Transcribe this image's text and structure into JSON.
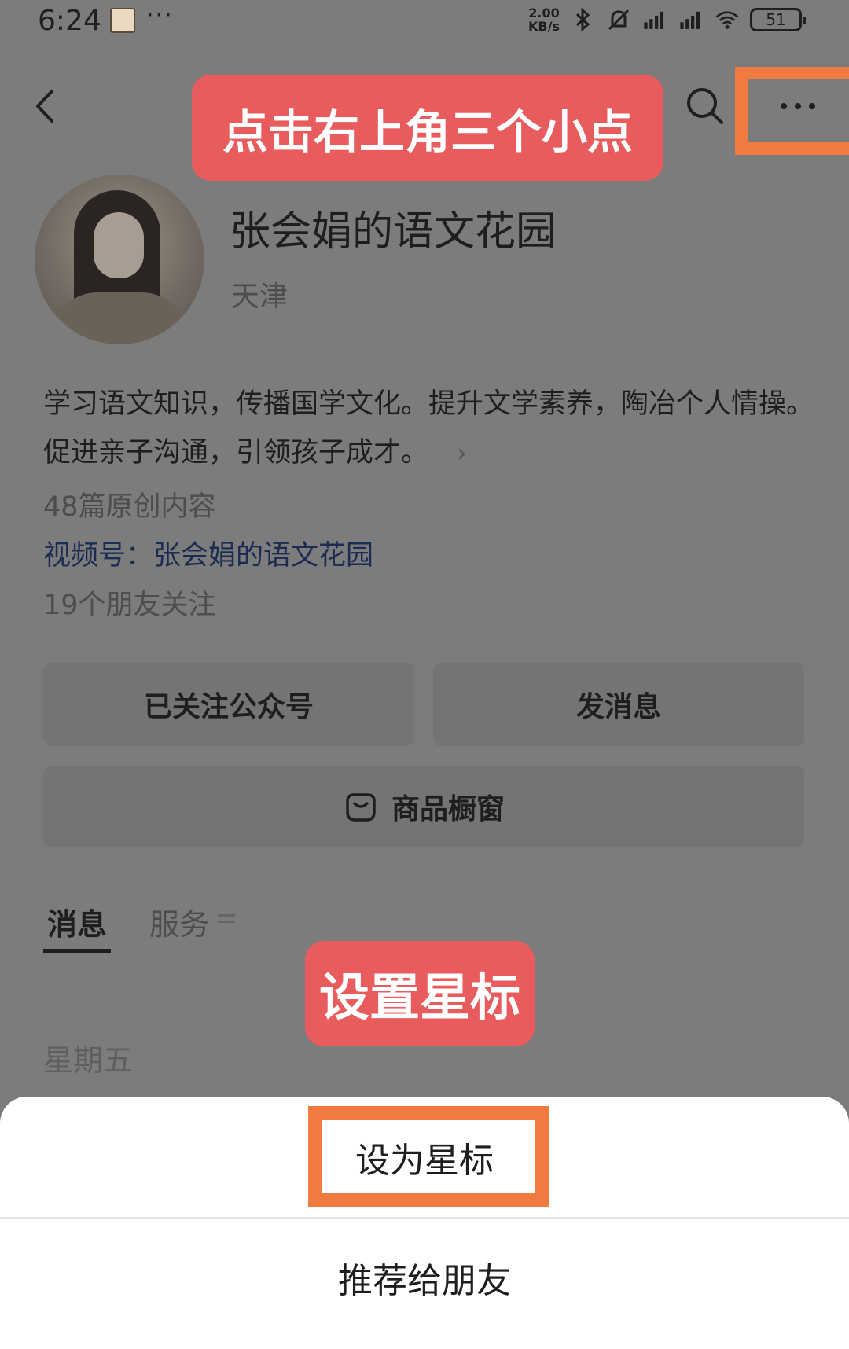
{
  "status_bar": {
    "time": "6:24",
    "more": "···",
    "net_speed_value": "2.00",
    "net_speed_unit": "KB/s",
    "battery": "51",
    "icons": [
      "app-avatar-icon",
      "bluetooth-icon",
      "mute-bell-icon",
      "signal-hd-icon",
      "signal-hd-icon",
      "wifi-icon",
      "battery-icon"
    ]
  },
  "header": {
    "back_icon": "back-chevron-icon",
    "search_icon": "search-icon",
    "more_icon": "more-dots-icon"
  },
  "annotations": {
    "callout_top": "点击右上角三个小点",
    "callout_star": "设置星标",
    "highlight_color": "#f07a3f",
    "callout_color": "#e95c5e"
  },
  "profile": {
    "name": "张会娟的语文花园",
    "location": "天津",
    "bio": "学习语文知识，传播国学文化。提升文学素养，陶冶个人情操。促进亲子沟通，引领孩子成才。",
    "bio_chevron": "›",
    "articles": "48篇原创内容",
    "channel": "视频号：张会娟的语文花园",
    "followers": "19个朋友关注"
  },
  "buttons": {
    "followed": "已关注公众号",
    "message": "发消息",
    "shop": "商品橱窗"
  },
  "tabs": {
    "messages": "消息",
    "service": "服务"
  },
  "feed": {
    "day_label": "星期五"
  },
  "action_sheet": {
    "set_star": "设为星标",
    "recommend": "推荐给朋友"
  }
}
